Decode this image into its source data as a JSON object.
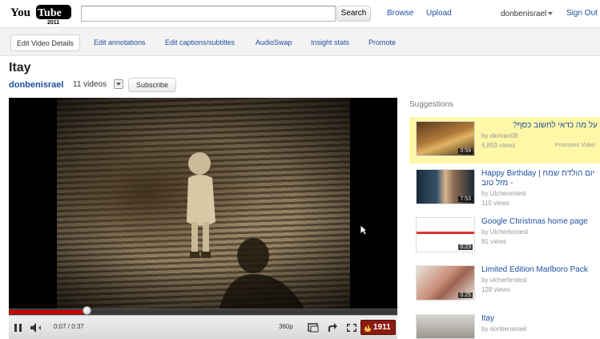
{
  "header": {
    "logo_text": "YouTube 2011",
    "search_placeholder": "",
    "search_button": "Search",
    "browse": "Browse",
    "upload": "Upload",
    "user": "donbenisrael",
    "sign_out": "Sign Out"
  },
  "owner_bar": {
    "items": [
      {
        "label": "Edit Video Details",
        "active": true
      },
      {
        "label": "Edit annotations",
        "active": false
      },
      {
        "label": "Edit captions/subtitles",
        "active": false
      },
      {
        "label": "AudioSwap",
        "active": false
      },
      {
        "label": "Insight stats",
        "active": false
      },
      {
        "label": "Promote",
        "active": false
      }
    ]
  },
  "video": {
    "title": "Itay",
    "channel": "donbenisrael",
    "video_count": "11 videos",
    "subscribe": "Subscribe"
  },
  "player": {
    "current_time": "0:07",
    "duration": "0:37",
    "time_text": "0:07 / 0:37",
    "progress_fraction": 0.2,
    "loaded_fraction": 0.2,
    "quality": "360p",
    "view_badge": "1911"
  },
  "suggestions": {
    "heading": "Suggestions",
    "items": [
      {
        "title": "על מה כדאי לחשוב כסף?",
        "by": "by dkrivan08",
        "views": "6,859 views",
        "extra": "Promoted Video",
        "duration": "0:59",
        "highlight": true
      },
      {
        "title": "Happy Birthday | יום הולדת שמח - מזל טוב",
        "by": "by Ulcherontest",
        "views": "110 views",
        "extra": "",
        "duration": "7:53",
        "highlight": false
      },
      {
        "title": "Google Christmas home page",
        "by": "by Ulcherbrotest",
        "views": "81 views",
        "extra": "",
        "duration": "0:23",
        "highlight": false
      },
      {
        "title": "Limited Edition Marlboro Pack",
        "by": "by ulcherbrotest",
        "views": "128 views",
        "extra": "",
        "duration": "0:25",
        "highlight": false
      },
      {
        "title": "Itay",
        "by": "by donbenisrael",
        "views": "",
        "extra": "",
        "duration": "",
        "highlight": false
      }
    ]
  },
  "colors": {
    "link": "#1f4fa0",
    "highlight": "#fff7a8",
    "progress": "#cc0000",
    "badge": "#8b1a12"
  }
}
